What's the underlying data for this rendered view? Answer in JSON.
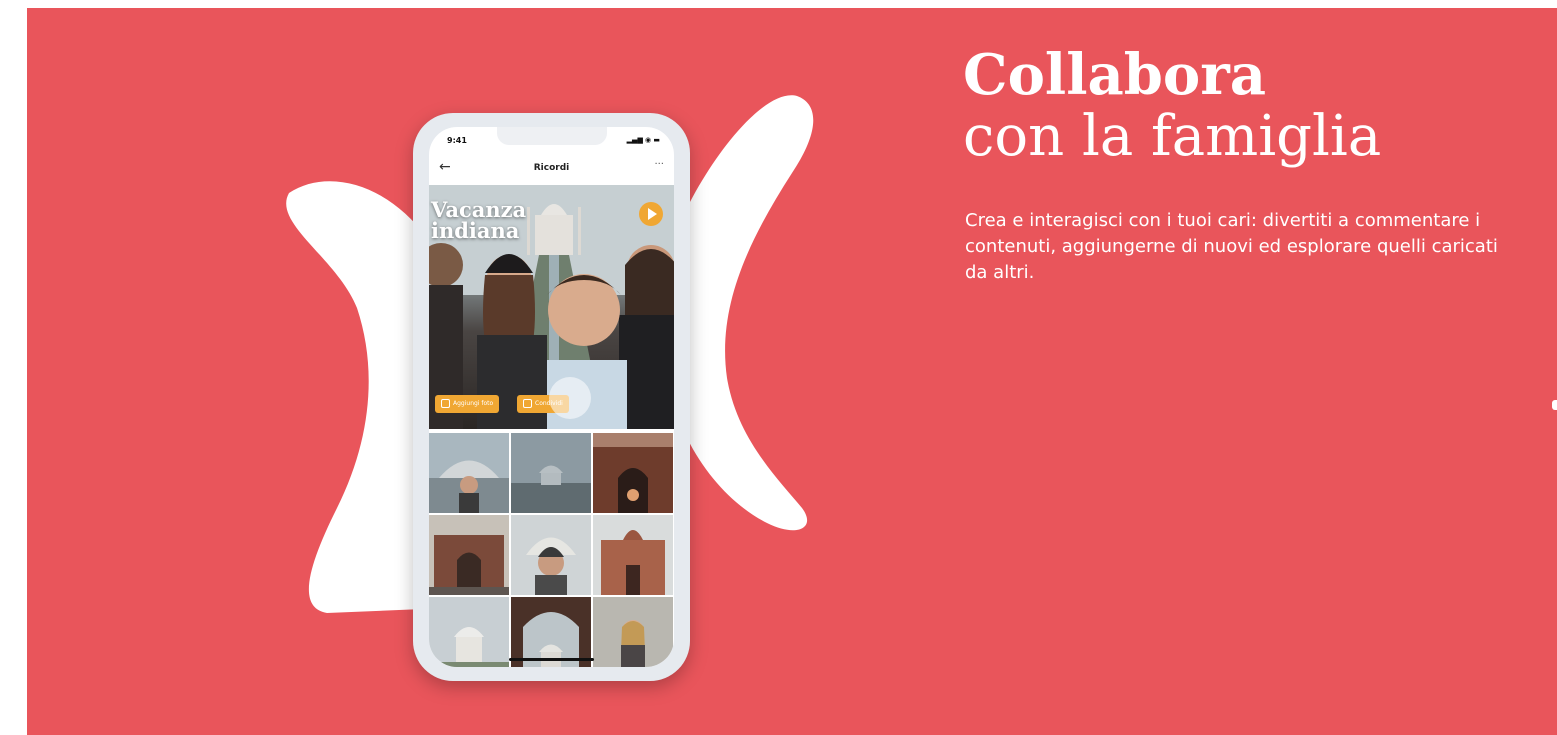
{
  "colors": {
    "background": "#e9555b",
    "accent": "#f0a733",
    "text": "#ffffff"
  },
  "heading": {
    "line1": "Collabora",
    "line2": "con la famiglia"
  },
  "description": "Crea e interagisci con i tuoi cari: divertiti a commentare i contenuti, aggiungerne di nuovi ed esplorare quelli caricati da altri.",
  "phone": {
    "status_time": "9:41",
    "nav_title": "Ricordi",
    "back_icon": "arrow-left-icon",
    "more_icon": "more-horizontal-icon",
    "album_title_line1": "Vacanza",
    "album_title_line2": "indiana",
    "play_icon": "play-icon",
    "buttons": [
      {
        "label": "Aggiungi foto"
      },
      {
        "label": "Condividi"
      }
    ]
  }
}
